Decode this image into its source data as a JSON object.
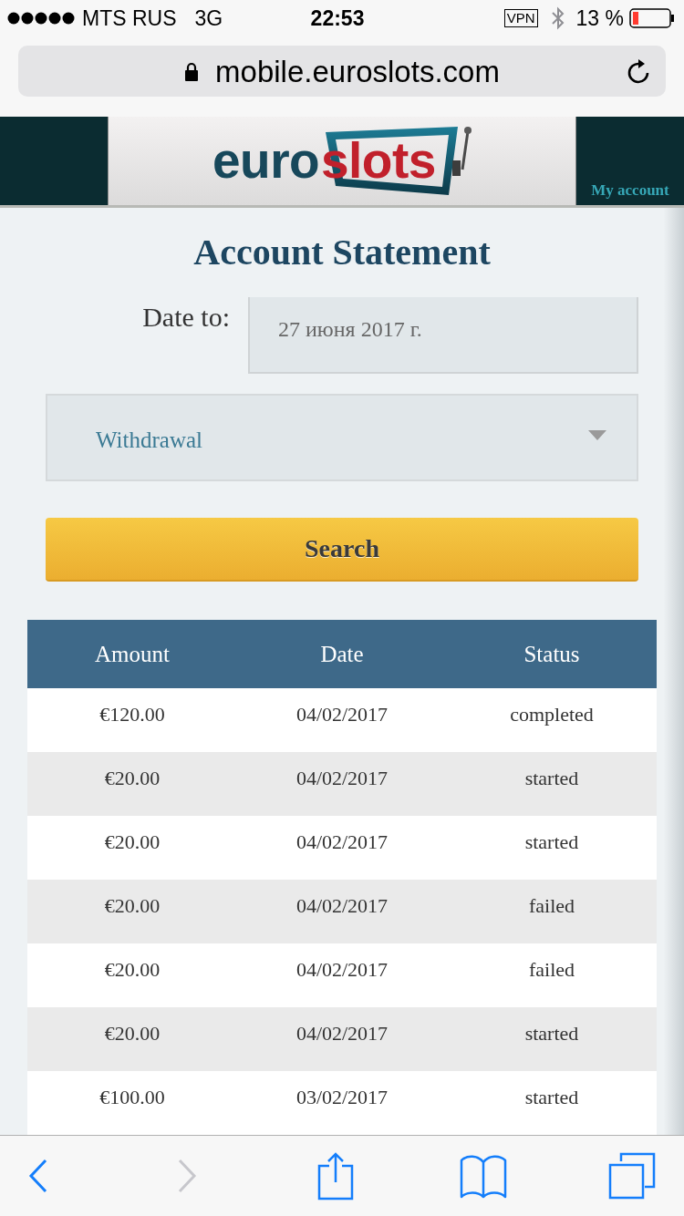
{
  "status_bar": {
    "carrier": "MTS RUS",
    "network": "3G",
    "time": "22:53",
    "vpn": "VPN",
    "battery": "13 %"
  },
  "address_bar": {
    "url": "mobile.euroslots.com"
  },
  "header": {
    "logo": {
      "text_1": "euro",
      "text_2": "slots"
    },
    "account_link": "My account"
  },
  "page_title": "Account Statement",
  "date_field": {
    "label": "Date to:",
    "value": "27 июня 2017 г."
  },
  "type_select": {
    "value": "Withdrawal"
  },
  "search_button": "Search",
  "table": {
    "columns": [
      "Amount",
      "Date",
      "Status"
    ],
    "rows": [
      [
        "€120.00",
        "04/02/2017",
        "completed"
      ],
      [
        "€20.00",
        "04/02/2017",
        "started"
      ],
      [
        "€20.00",
        "04/02/2017",
        "started"
      ],
      [
        "€20.00",
        "04/02/2017",
        "failed"
      ],
      [
        "€20.00",
        "04/02/2017",
        "failed"
      ],
      [
        "€20.00",
        "04/02/2017",
        "started"
      ],
      [
        "€100.00",
        "03/02/2017",
        "started"
      ]
    ]
  },
  "toolbar": [
    {
      "kind": "back",
      "disabled": false
    },
    {
      "kind": "forward",
      "disabled": true
    },
    {
      "kind": "share",
      "disabled": false
    },
    {
      "kind": "bookmarks",
      "disabled": false
    },
    {
      "kind": "tabs",
      "disabled": false
    }
  ]
}
